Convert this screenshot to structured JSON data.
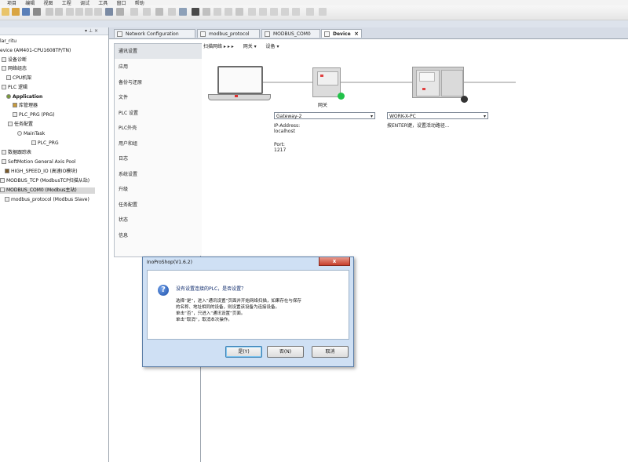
{
  "menu": [
    "项目",
    "编辑",
    "视图",
    "工程",
    "调试",
    "工具",
    "窗口",
    "帮助"
  ],
  "tree": {
    "header_pin": "▾ ⊥ ×",
    "items": [
      {
        "label": "lar_ritu",
        "bold": false
      },
      {
        "label": "evice (AM401-CPU1608TP/TN)",
        "bold": false
      },
      {
        "label": "设备诊断",
        "bold": false
      },
      {
        "label": "网络组态",
        "bold": false
      },
      {
        "label": "CPU机架",
        "bold": false
      },
      {
        "label": "PLC 逻辑",
        "bold": false
      },
      {
        "label": "Application",
        "bold": true
      },
      {
        "label": "库管理器",
        "bold": false
      },
      {
        "label": "PLC_PRG (PRG)",
        "bold": false
      },
      {
        "label": "任务配置",
        "bold": false
      },
      {
        "label": "MainTask",
        "bold": false
      },
      {
        "label": "PLC_PRG",
        "bold": false
      },
      {
        "label": "数据跟踪表",
        "bold": false
      },
      {
        "label": "SoftMotion General Axis Pool",
        "bold": false
      },
      {
        "label": "HIGH_SPEED_IO (高速IO模块)",
        "bold": false
      },
      {
        "label": "MODBUS_TCP (ModbusTCP扫描从站)",
        "bold": false
      },
      {
        "label": "MODBUS_COM0 (Modbus主站)",
        "bold": false
      },
      {
        "label": "modbus_protocol (Modbus Slave)",
        "bold": false
      }
    ]
  },
  "tabs": [
    {
      "label": "Network Configuration",
      "active": false
    },
    {
      "label": "modbus_protocol",
      "active": false
    },
    {
      "label": "MODBUS_COM0",
      "active": false
    },
    {
      "label": "Device",
      "active": true,
      "close": "×"
    }
  ],
  "device_nav": [
    "通讯设置",
    "应用",
    "备份与还原",
    "文件",
    "PLC 设置",
    "PLC外壳",
    "用户和组",
    "日志",
    "系统设置",
    "升级",
    "任务配置",
    "状态",
    "信息"
  ],
  "scanbar": {
    "scan": "扫描网络 ▸ ▸ ▸",
    "gateway": "网关 ▾",
    "device": "设备 ▾"
  },
  "gateway": {
    "label": "网关",
    "combo": "Gateway-2",
    "ip_label": "IP-Address:",
    "ip_value": "localhost",
    "port_label": "Port:",
    "port_value": "1217"
  },
  "plc": {
    "combo": "WORK-X-PC",
    "hint": "按ENTER键，设置活动路径..."
  },
  "dialog": {
    "title": "InoProShop(V1.6.2)",
    "close": "x",
    "question": "没有设置连接的PLC，是否设置？",
    "lines": [
      "选择“是”，进入“通讯设置”页面并开始网络扫描，如果存在与保存",
      "的名称、地址相同的设备，则设置该设备为连接设备。",
      "单击“否”，只进入“通讯设置”页面。",
      "单击“取消”，取消本次操作。"
    ],
    "yes": "是(Y)",
    "no": "否(N)",
    "cancel": "取消"
  }
}
